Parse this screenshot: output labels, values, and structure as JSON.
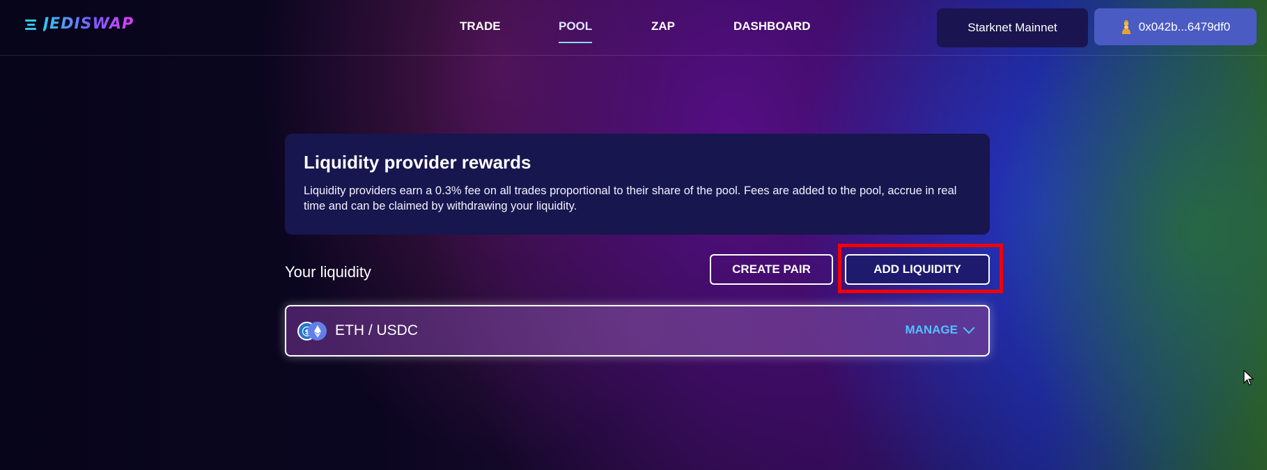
{
  "header": {
    "logo_text": "JEDISWAP",
    "nav": [
      {
        "label": "TRADE",
        "active": false
      },
      {
        "label": "POOL",
        "active": true
      },
      {
        "label": "ZAP",
        "active": false
      },
      {
        "label": "DASHBOARD",
        "active": false
      }
    ],
    "network_label": "Starknet Mainnet",
    "wallet_address": "0x042b...6479df0",
    "wallet_icon": "wallet-avatar-icon"
  },
  "rewards": {
    "title": "Liquidity provider rewards",
    "text": "Liquidity providers earn a 0.3% fee on all trades proportional to their share of the pool. Fees are added to the pool, accrue in real time and can be claimed by withdrawing your liquidity."
  },
  "liquidity": {
    "heading": "Your liquidity",
    "create_pair_label": "CREATE PAIR",
    "add_liquidity_label": "ADD LIQUIDITY",
    "pairs": [
      {
        "name": "ETH / USDC",
        "manage_label": "MANAGE",
        "icons": [
          "usdc-icon",
          "eth-icon"
        ]
      }
    ]
  },
  "colors": {
    "accent_blue": "#4fc3ff",
    "highlight_red": "#f40000",
    "card_bg": "#17164e"
  }
}
